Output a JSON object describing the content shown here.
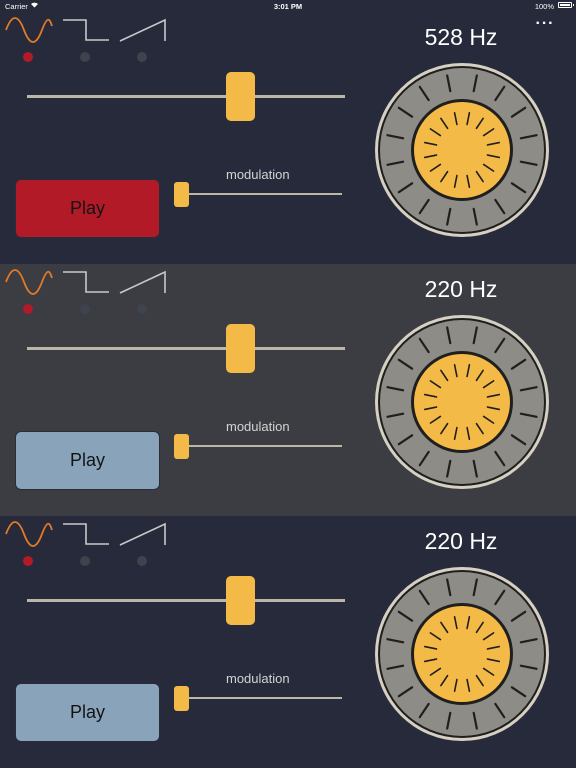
{
  "status_bar": {
    "carrier": "Carrier",
    "time": "3:01 PM",
    "battery": "100%"
  },
  "menu": {
    "more_label": "···"
  },
  "colors": {
    "accent": "#f4ba48",
    "sine_wave": "#e07a28",
    "selected_dot": "#b31a28",
    "unselected_dot": "#3f434d",
    "play_active": "#b31a28",
    "play_inactive": "#89a4ba",
    "knob_ring": "#8e8c86",
    "knob_center": "#f4ba48"
  },
  "waveform_icons": [
    "sine-wave-icon",
    "square-wave-icon",
    "sawtooth-wave-icon"
  ],
  "oscillators": [
    {
      "frequency": "528 Hz",
      "selected_waveform": "sine",
      "play_label": "Play",
      "playing": true,
      "modulation_label": "modulation",
      "frequency_slider_value": 0.69,
      "modulation_slider_value": 0.0
    },
    {
      "frequency": "220 Hz",
      "selected_waveform": "sine",
      "play_label": "Play",
      "playing": false,
      "modulation_label": "modulation",
      "frequency_slider_value": 0.69,
      "modulation_slider_value": 0.0
    },
    {
      "frequency": "220 Hz",
      "selected_waveform": "sine",
      "play_label": "Play",
      "playing": false,
      "modulation_label": "modulation",
      "frequency_slider_value": 0.69,
      "modulation_slider_value": 0.0
    }
  ]
}
